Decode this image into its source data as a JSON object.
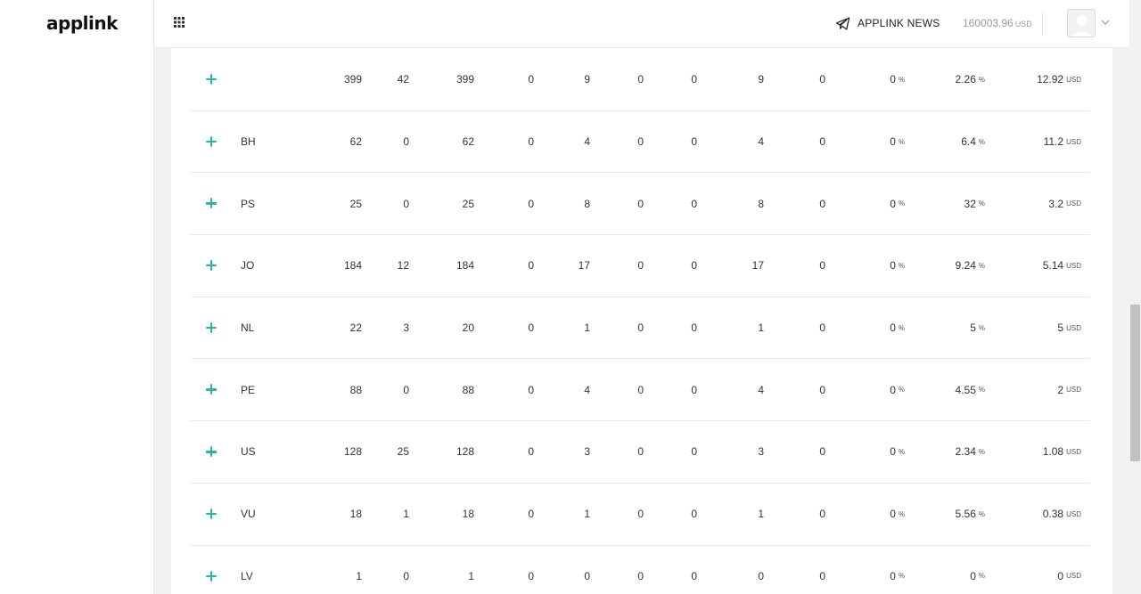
{
  "brand": {
    "logo_text": "applink"
  },
  "header": {
    "news_label": "APPLINK NEWS",
    "balance_value": "160003.96",
    "balance_currency": "USD"
  },
  "table": {
    "rows": [
      {
        "country": "",
        "c1": "399",
        "c2": "42",
        "c3": "399",
        "c4": "0",
        "c5": "9",
        "c6": "0",
        "c7": "0",
        "c8": "9",
        "c9": "0",
        "pct1": "0",
        "pct2": "2.26",
        "usd": "12.92"
      },
      {
        "country": "BH",
        "c1": "62",
        "c2": "0",
        "c3": "62",
        "c4": "0",
        "c5": "4",
        "c6": "0",
        "c7": "0",
        "c8": "4",
        "c9": "0",
        "pct1": "0",
        "pct2": "6.4",
        "usd": "11.2"
      },
      {
        "country": "PS",
        "c1": "25",
        "c2": "0",
        "c3": "25",
        "c4": "0",
        "c5": "8",
        "c6": "0",
        "c7": "0",
        "c8": "8",
        "c9": "0",
        "pct1": "0",
        "pct2": "32",
        "usd": "3.2"
      },
      {
        "country": "JO",
        "c1": "184",
        "c2": "12",
        "c3": "184",
        "c4": "0",
        "c5": "17",
        "c6": "0",
        "c7": "0",
        "c8": "17",
        "c9": "0",
        "pct1": "0",
        "pct2": "9.24",
        "usd": "5.14"
      },
      {
        "country": "NL",
        "c1": "22",
        "c2": "3",
        "c3": "20",
        "c4": "0",
        "c5": "1",
        "c6": "0",
        "c7": "0",
        "c8": "1",
        "c9": "0",
        "pct1": "0",
        "pct2": "5",
        "usd": "5"
      },
      {
        "country": "PE",
        "c1": "88",
        "c2": "0",
        "c3": "88",
        "c4": "0",
        "c5": "4",
        "c6": "0",
        "c7": "0",
        "c8": "4",
        "c9": "0",
        "pct1": "0",
        "pct2": "4.55",
        "usd": "2"
      },
      {
        "country": "US",
        "c1": "128",
        "c2": "25",
        "c3": "128",
        "c4": "0",
        "c5": "3",
        "c6": "0",
        "c7": "0",
        "c8": "3",
        "c9": "0",
        "pct1": "0",
        "pct2": "2.34",
        "usd": "1.08"
      },
      {
        "country": "VU",
        "c1": "18",
        "c2": "1",
        "c3": "18",
        "c4": "0",
        "c5": "1",
        "c6": "0",
        "c7": "0",
        "c8": "1",
        "c9": "0",
        "pct1": "0",
        "pct2": "5.56",
        "usd": "0.38"
      },
      {
        "country": "LV",
        "c1": "1",
        "c2": "0",
        "c3": "1",
        "c4": "0",
        "c5": "0",
        "c6": "0",
        "c7": "0",
        "c8": "0",
        "c9": "0",
        "pct1": "0",
        "pct2": "0",
        "usd": "0"
      }
    ],
    "percent_symbol": "%",
    "currency_symbol": "USD"
  },
  "icons": {
    "apps": "apps-grid-icon",
    "news": "telegram-send-icon",
    "avatar": "user-avatar-icon",
    "caret": "chevron-down-icon",
    "expand": "plus-icon"
  },
  "colors": {
    "accent": "#2bb3a6"
  }
}
